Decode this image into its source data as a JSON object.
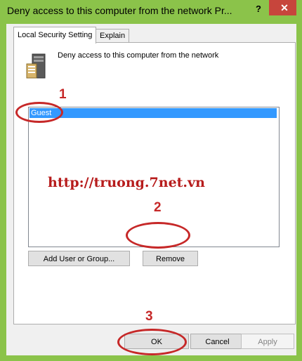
{
  "window": {
    "title": "Deny access to this computer from the network Pr...",
    "help": "?",
    "close": "✕"
  },
  "tabs": [
    {
      "label": "Local Security Setting"
    },
    {
      "label": "Explain"
    }
  ],
  "policy": {
    "title": "Deny access to this computer from the network",
    "icon": "server-icon"
  },
  "list": {
    "items": [
      "Guest"
    ]
  },
  "watermark": "http://truong.7net.vn",
  "buttons": {
    "add": "Add User or Group...",
    "remove": "Remove",
    "ok": "OK",
    "cancel": "Cancel",
    "apply": "Apply"
  },
  "annotations": [
    "1",
    "2",
    "3"
  ],
  "colors": {
    "frame": "#8bc34a",
    "close": "#c7453c",
    "selection": "#3399ff",
    "annotation": "#c62828"
  }
}
